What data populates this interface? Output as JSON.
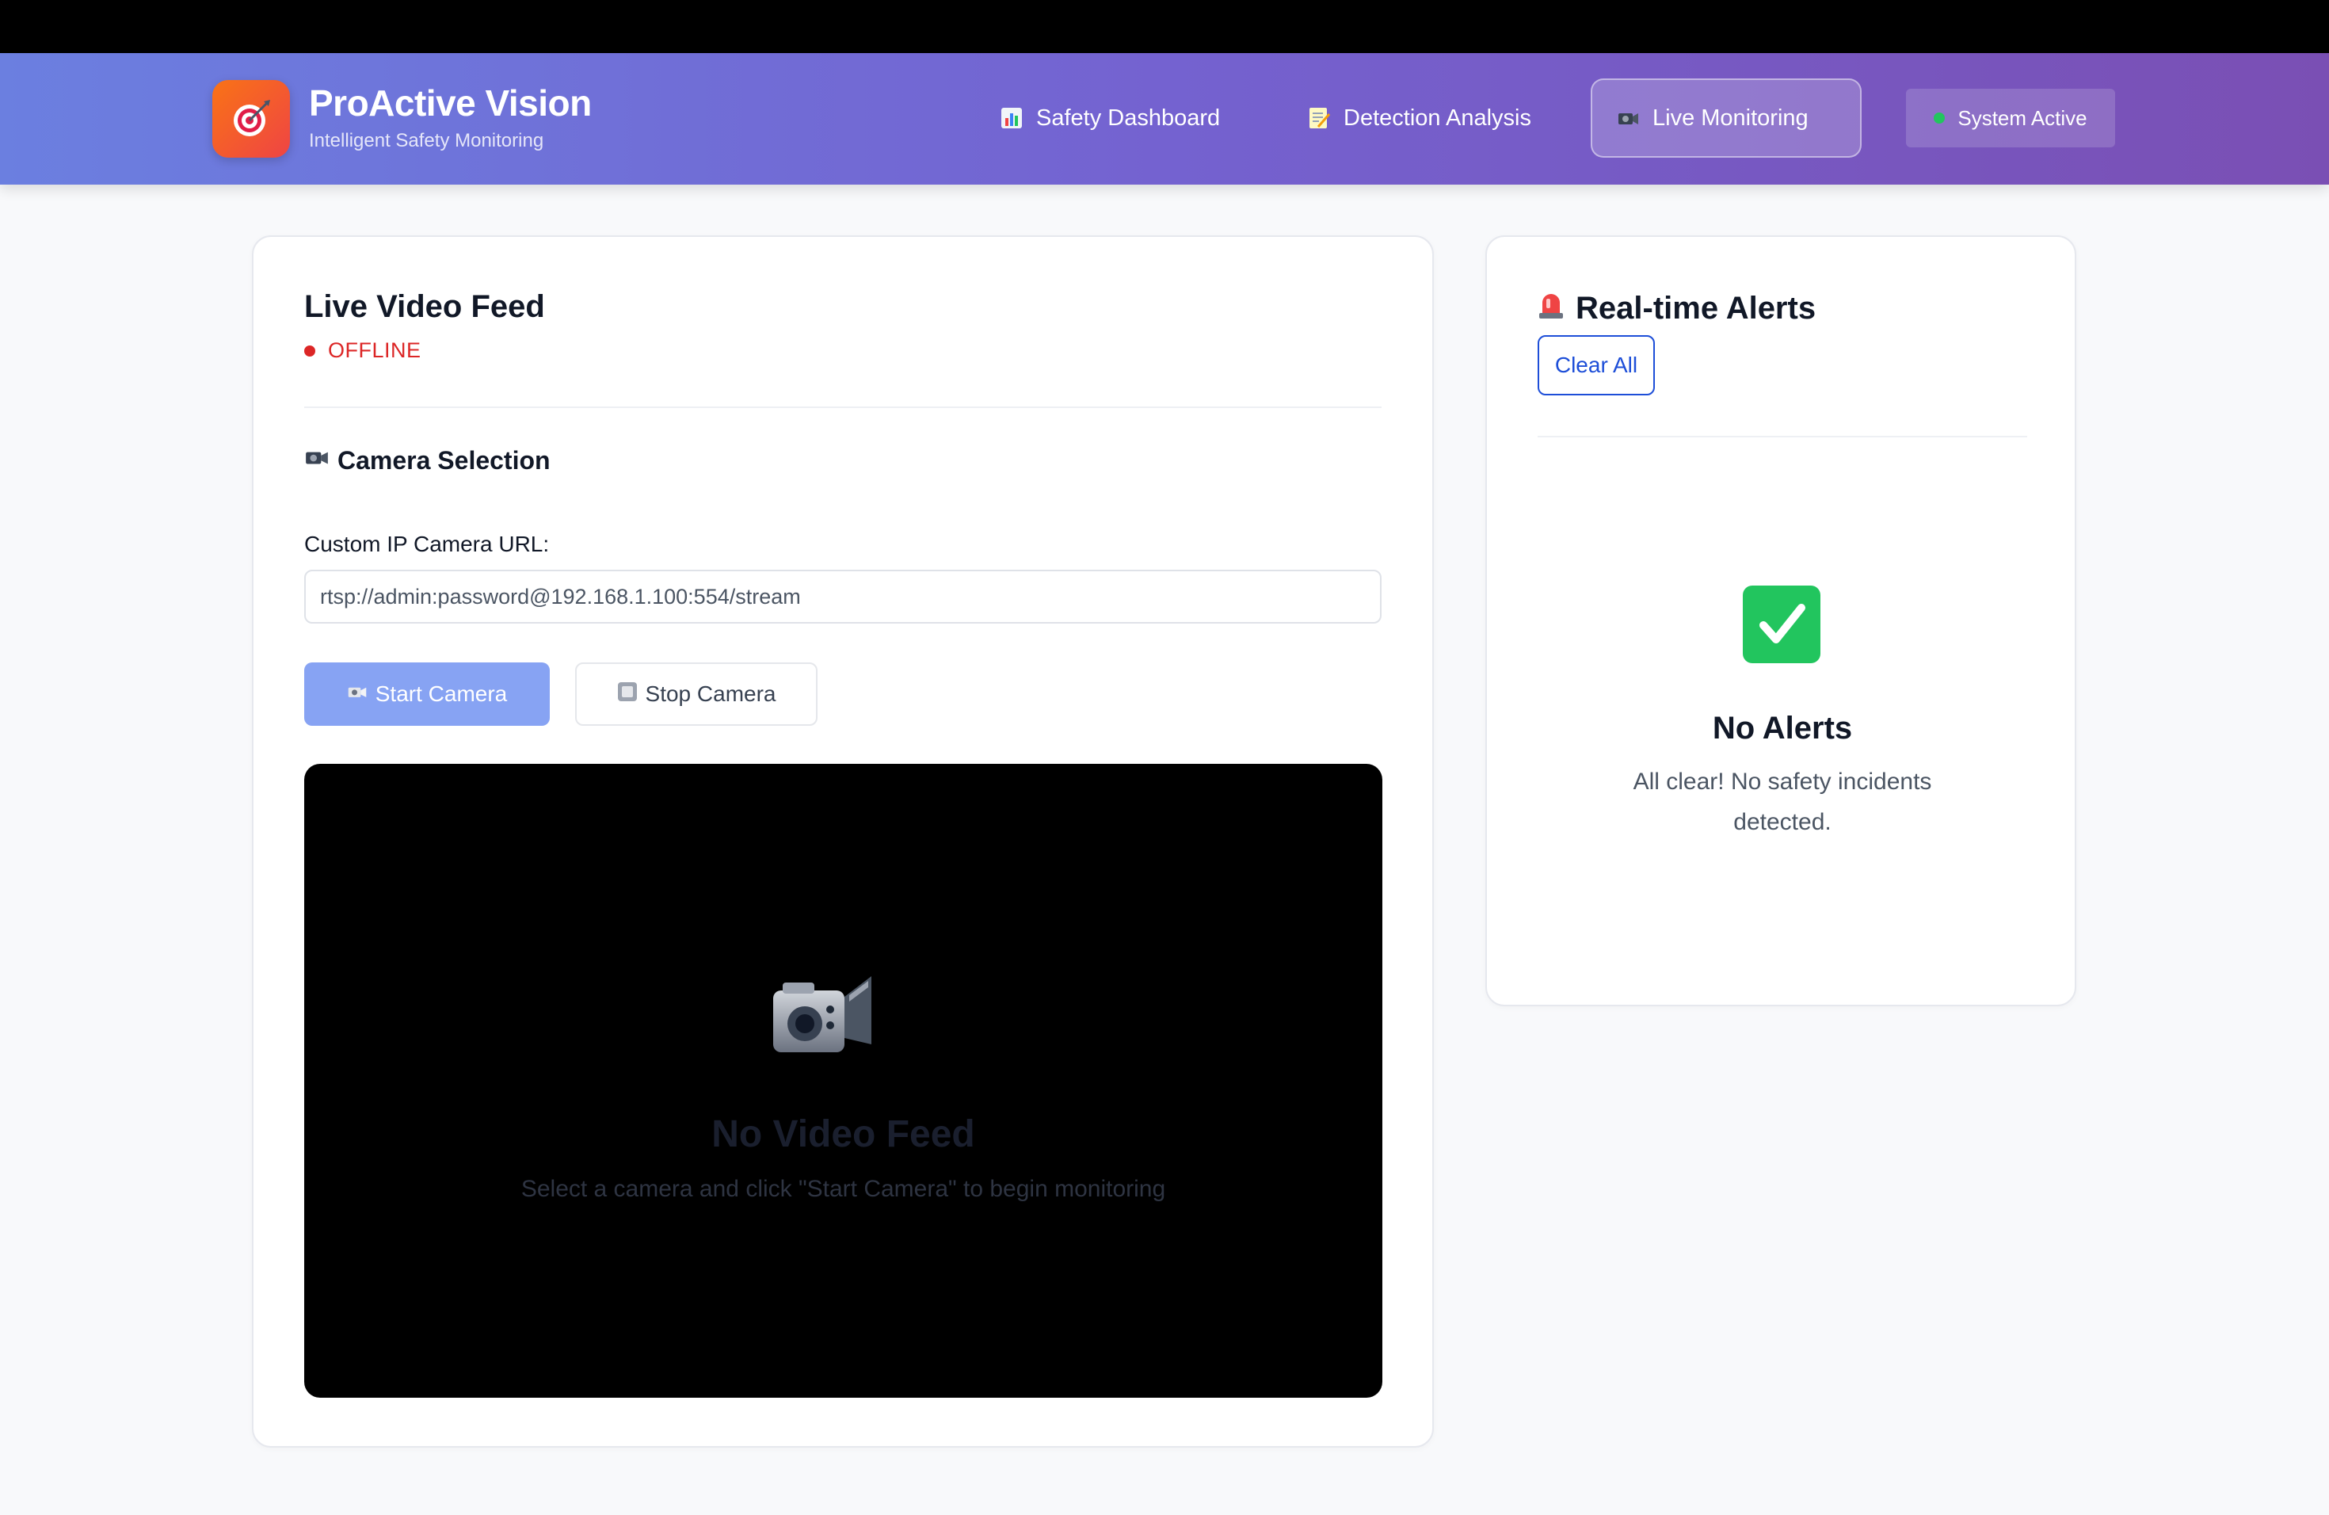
{
  "app": {
    "name": "ProActive Vision",
    "tagline": "Intelligent Safety Monitoring"
  },
  "nav": {
    "items": [
      {
        "label": "Safety Dashboard",
        "icon": "bar-chart-icon"
      },
      {
        "label": "Detection Analysis",
        "icon": "memo-icon"
      },
      {
        "label": "Live Monitoring",
        "icon": "video-camera-icon",
        "active": true
      }
    ],
    "status": "System Active"
  },
  "feed": {
    "title": "Live Video Feed",
    "status": "OFFLINE",
    "camera_section_title": "Camera Selection",
    "url_label": "Custom IP Camera URL:",
    "url_value": "rtsp://admin:password@192.168.1.100:554/stream",
    "start_label": "Start Camera",
    "stop_label": "Stop Camera",
    "no_feed_title": "No Video Feed",
    "no_feed_hint": "Select a camera and click \"Start Camera\" to begin monitoring"
  },
  "alerts": {
    "title": "Real-time Alerts",
    "clear_label": "Clear All",
    "empty_title": "No Alerts",
    "empty_message": "All clear! No safety incidents detected."
  },
  "colors": {
    "header_start": "#6b7fe0",
    "header_end": "#7a4fb4",
    "offline": "#dc2626",
    "status_active": "#22c55e",
    "primary_button": "#87a3f3",
    "link_blue": "#1d4ed8"
  }
}
